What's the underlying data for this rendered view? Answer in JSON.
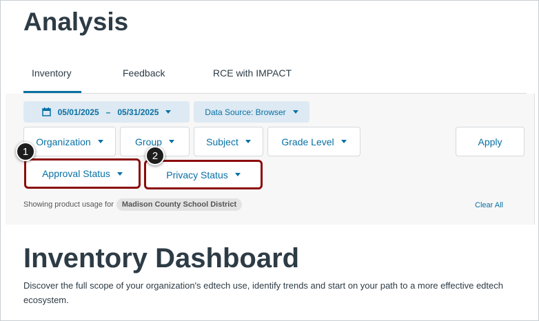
{
  "header": {
    "title": "Analysis"
  },
  "tabs": [
    {
      "label": "Inventory",
      "active": true
    },
    {
      "label": "Feedback"
    },
    {
      "label": "RCE with IMPACT"
    }
  ],
  "filters": {
    "date_start": "05/01/2025",
    "date_sep": "–",
    "date_end": "05/31/2025",
    "data_source": "Data Source: Browser",
    "organization": "Organization",
    "group": "Group",
    "subject": "Subject",
    "grade_level": "Grade Level",
    "apply": "Apply",
    "approval_status": "Approval Status",
    "privacy_status": "Privacy Status",
    "showing_label": "Showing product usage for",
    "district": "Madison County School District",
    "clear_all": "Clear All"
  },
  "callouts": [
    "1",
    "2"
  ],
  "dashboard": {
    "title": "Inventory Dashboard",
    "description": "Discover the full scope of your organization's edtech use, identify trends and start on your path to a more effective edtech ecosystem."
  },
  "colors": {
    "accent": "#0770a3",
    "highlight": "#8b0a0a"
  }
}
